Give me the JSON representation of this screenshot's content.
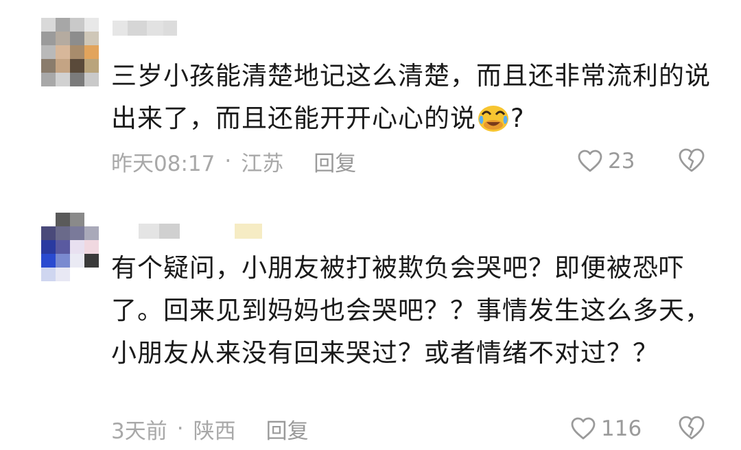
{
  "comments": [
    {
      "username": "",
      "text_before_emoji": "三岁小孩能清楚地记这么清楚，而且还非常流利的说出来了，而且还能开开心心的说",
      "emoji": "crying-laughing-emoji",
      "text_after_emoji": "?",
      "time": "昨天08:17",
      "separator": "·",
      "location": "江苏",
      "reply_label": "回复",
      "like_count": "23"
    },
    {
      "username": "",
      "text_before_emoji": "有个疑问，小朋友被打被欺负会哭吧？即便被恐吓了。回来见到妈妈也会哭吧？？事情发生这么多天，小朋友从来没有回来哭过？或者情绪不对过？？",
      "time": "3天前",
      "separator": "·",
      "location": "陕西",
      "reply_label": "回复",
      "like_count": "116"
    }
  ],
  "icons": {
    "like": "heart-outline-icon",
    "dislike": "broken-heart-icon"
  },
  "colors": {
    "text": "#1a1a1a",
    "meta": "#a8a8a8",
    "icon": "#9a9a9a"
  }
}
